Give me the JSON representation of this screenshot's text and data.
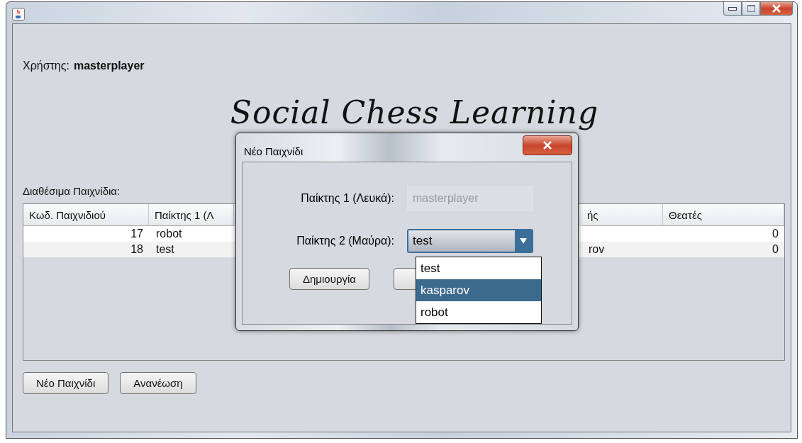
{
  "window": {
    "user_label": "Χρήστης:",
    "user_name": "masterplayer",
    "logo": "Social Chess Learning"
  },
  "games_label": "Διαθέσιμα Παιχνίδια:",
  "table": {
    "columns": {
      "code": "Κωδ. Παιχνιδιού",
      "player_1": "Παίκτης 1 (Λ",
      "column_4": "ής",
      "spectators": "Θεατές"
    },
    "rows": [
      {
        "code": "17",
        "player_1": "robot",
        "spectators": "0",
        "selected": false
      },
      {
        "code": "18",
        "player_1": "test",
        "column_4": "rov",
        "spectators": "0",
        "selected": false
      }
    ]
  },
  "buttons": [
    "Νέο Παιχνίδι",
    "Ανανέωση"
  ],
  "dialog": {
    "title": "Νέο Παιχνίδι",
    "player_1_label": "Παίκτης 1 (Λευκά):",
    "player_1_value": "masterplayer",
    "player_1_disabled": true,
    "player_2_label": "Παίκτης 2 (Μαύρα):",
    "player_2_value": "test",
    "create_button": "Δημιουργία",
    "dropdown": [
      {
        "label": "test",
        "selected": false
      },
      {
        "label": "kasparov",
        "selected": true
      },
      {
        "label": "robot",
        "selected": false
      }
    ]
  }
}
